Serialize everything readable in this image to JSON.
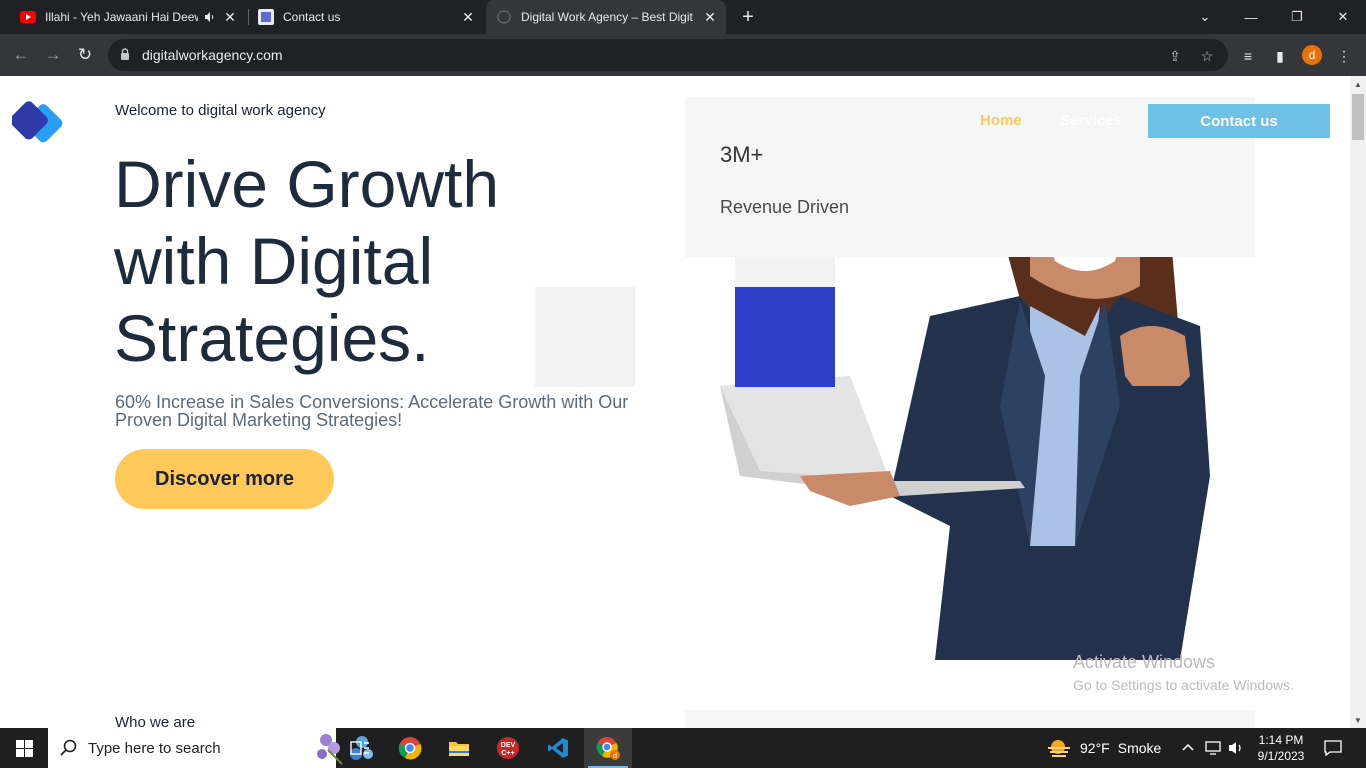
{
  "browser": {
    "tabs": [
      {
        "title": "Illahi - Yeh Jawaani Hai Deew",
        "favicon": "youtube-icon",
        "audio": true
      },
      {
        "title": "Contact us",
        "favicon": "site-icon"
      },
      {
        "title": "Digital Work Agency – Best Digit",
        "favicon": "globe-icon",
        "active": true
      }
    ],
    "url": "digitalworkagency.com",
    "profile_initial": "d"
  },
  "page": {
    "welcome": "Welcome to digital work agency",
    "headline": [
      "Drive Growth",
      "with Digital",
      "Strategies."
    ],
    "subtext": "60% Increase in Sales Conversions: Accelerate Growth with Our Proven Digital Marketing Strategies!",
    "cta_label": "Discover more",
    "nav": {
      "home": "Home",
      "services": "Services",
      "contact": "Contact us"
    },
    "stat": {
      "value": "3M+",
      "label": "Revenue Driven"
    },
    "section_label": "Who we are",
    "colors": {
      "accent_yellow": "#ffc959",
      "accent_blue": "#2d3ec9",
      "contact_blue": "#6ec1e4",
      "heading": "#1e2b3c"
    }
  },
  "watermark": {
    "title": "Activate Windows",
    "subtitle": "Go to Settings to activate Windows."
  },
  "taskbar": {
    "search_placeholder": "Type here to search",
    "apps": [
      "task-view-icon",
      "chrome-icon",
      "file-explorer-icon",
      "dev-cpp-icon",
      "vscode-icon",
      "chrome-profile-icon"
    ],
    "weather": {
      "temp": "92°F",
      "condition": "Smoke"
    },
    "time": "1:14 PM",
    "date": "9/1/2023"
  }
}
